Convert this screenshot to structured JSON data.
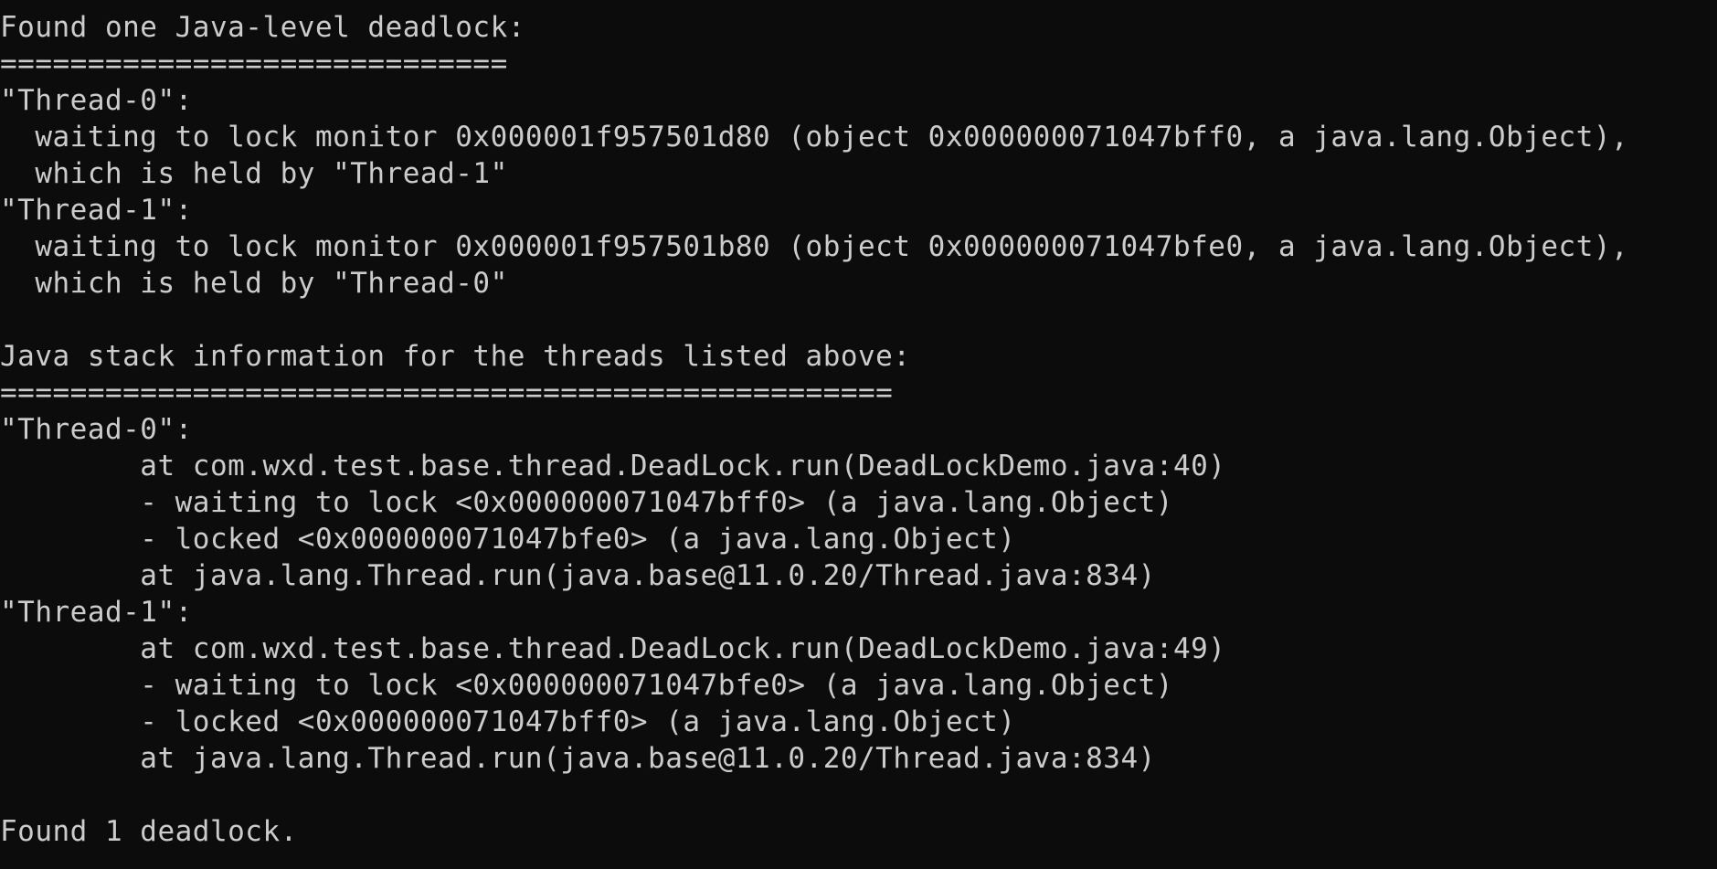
{
  "terminal": {
    "lines": [
      "Found one Java-level deadlock:",
      "=============================",
      "\"Thread-0\":",
      "  waiting to lock monitor 0x000001f957501d80 (object 0x000000071047bff0, a java.lang.Object),",
      "  which is held by \"Thread-1\"",
      "\"Thread-1\":",
      "  waiting to lock monitor 0x000001f957501b80 (object 0x000000071047bfe0, a java.lang.Object),",
      "  which is held by \"Thread-0\"",
      "",
      "Java stack information for the threads listed above:",
      "===================================================",
      "\"Thread-0\":",
      "        at com.wxd.test.base.thread.DeadLock.run(DeadLockDemo.java:40)",
      "        - waiting to lock <0x000000071047bff0> (a java.lang.Object)",
      "        - locked <0x000000071047bfe0> (a java.lang.Object)",
      "        at java.lang.Thread.run(java.base@11.0.20/Thread.java:834)",
      "\"Thread-1\":",
      "        at com.wxd.test.base.thread.DeadLock.run(DeadLockDemo.java:49)",
      "        - waiting to lock <0x000000071047bfe0> (a java.lang.Object)",
      "        - locked <0x000000071047bff0> (a java.lang.Object)",
      "        at java.lang.Thread.run(java.base@11.0.20/Thread.java:834)",
      "",
      "Found 1 deadlock."
    ]
  },
  "colors": {
    "background": "#0c0c0c",
    "foreground": "#cccccc"
  }
}
